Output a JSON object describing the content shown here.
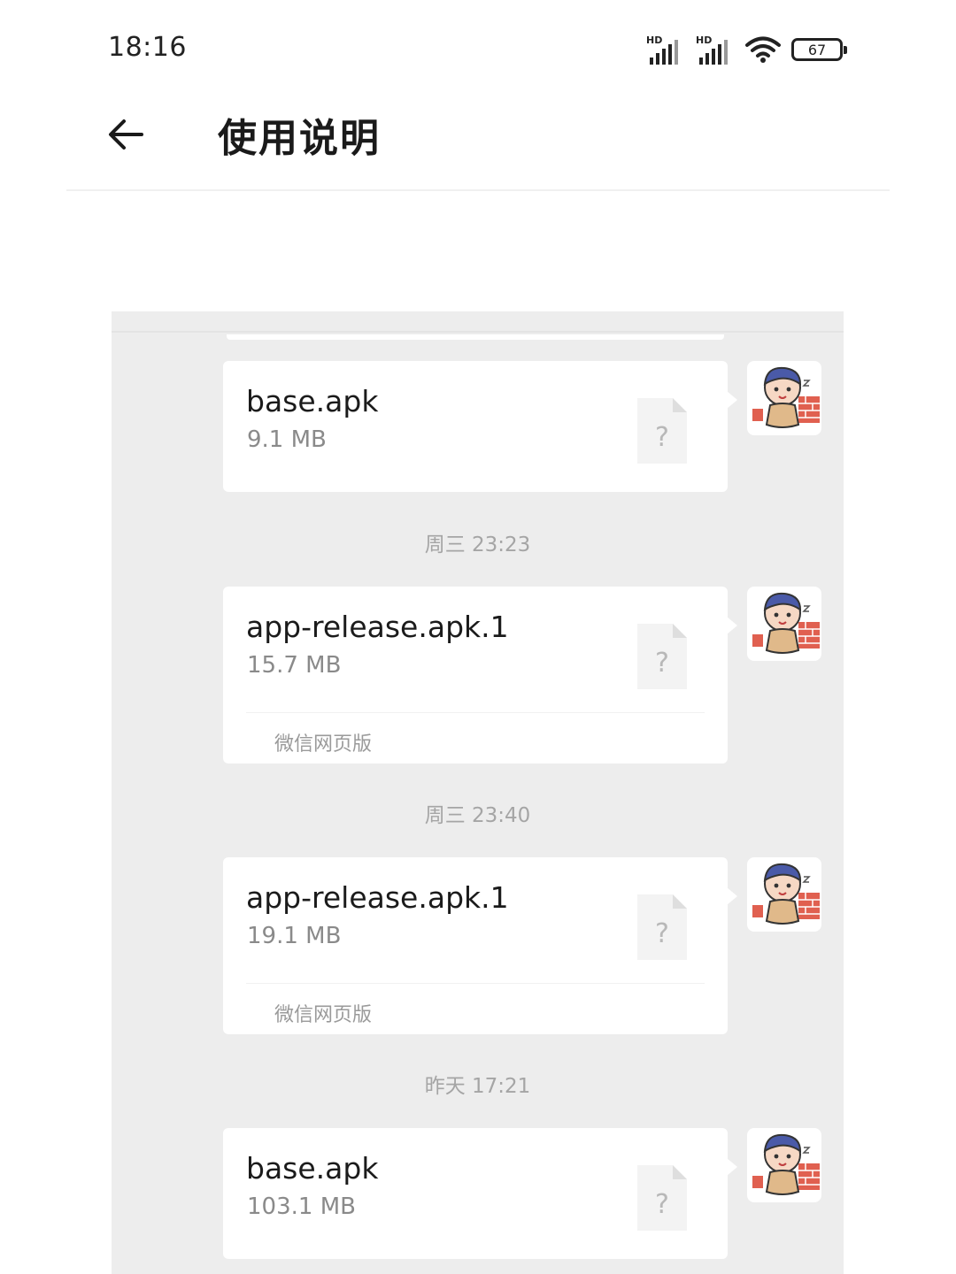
{
  "status_bar": {
    "time": "18:16",
    "sim1_label": "HD",
    "sim2_label": "HD",
    "battery_level": "67",
    "icons": [
      "signal-icon",
      "signal-icon",
      "wifi-icon",
      "battery-icon"
    ]
  },
  "header": {
    "back_icon": "arrow-left-icon",
    "title": "使用说明"
  },
  "chat": {
    "messages": [
      {
        "file_name": "base.apk",
        "size": "9.1 MB",
        "source": "",
        "icon": "unknown-file-icon"
      },
      {
        "file_name": "app-release.apk.1",
        "size": "15.7 MB",
        "source": "微信网页版",
        "icon": "unknown-file-icon"
      },
      {
        "file_name": "app-release.apk.1",
        "size": "19.1 MB",
        "source": "微信网页版",
        "icon": "unknown-file-icon"
      },
      {
        "file_name": "base.apk",
        "size": "103.1 MB",
        "source": "",
        "icon": "unknown-file-icon"
      }
    ],
    "timestamps": [
      "周三 23:23",
      "周三 23:40",
      "昨天 17:21"
    ],
    "file_icon_glyph": "?",
    "avatar_icon": "cartoon-boy-avatar"
  },
  "colors": {
    "chat_background": "#ededed",
    "bubble": "#ffffff",
    "timestamp_text": "#a5a5a5",
    "size_text": "#8a8a8a"
  }
}
